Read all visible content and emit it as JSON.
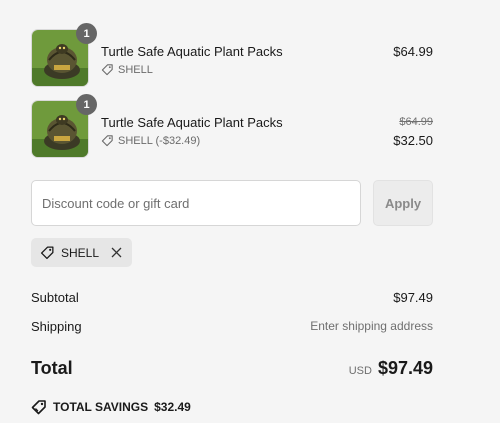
{
  "line_items": [
    {
      "title": "Turtle Safe Aquatic Plant Packs",
      "quantity": "1",
      "discount_label": "SHELL",
      "price": "$64.99",
      "icon": "tag-icon"
    },
    {
      "title": "Turtle Safe Aquatic Plant Packs",
      "quantity": "1",
      "discount_label": "SHELL (-$32.49)",
      "original_price": "$64.99",
      "price": "$32.50",
      "icon": "tag-icon"
    }
  ],
  "discount": {
    "placeholder": "Discount code or gift card",
    "value": "",
    "apply_label": "Apply"
  },
  "applied_code": {
    "label": "SHELL",
    "icon": "tag-icon",
    "remove_icon": "close-icon"
  },
  "summary": {
    "subtotal_label": "Subtotal",
    "subtotal_value": "$97.49",
    "shipping_label": "Shipping",
    "shipping_value": "Enter shipping address",
    "total_label": "Total",
    "currency": "USD",
    "total_value": "$97.49"
  },
  "savings": {
    "label": "TOTAL SAVINGS",
    "value": "$32.49",
    "icon": "savings-tag-icon"
  },
  "colors": {
    "background": "#f5f5f5",
    "badge": "#666666",
    "chip": "#e6e6e6",
    "muted_text": "#6f6f6f"
  }
}
